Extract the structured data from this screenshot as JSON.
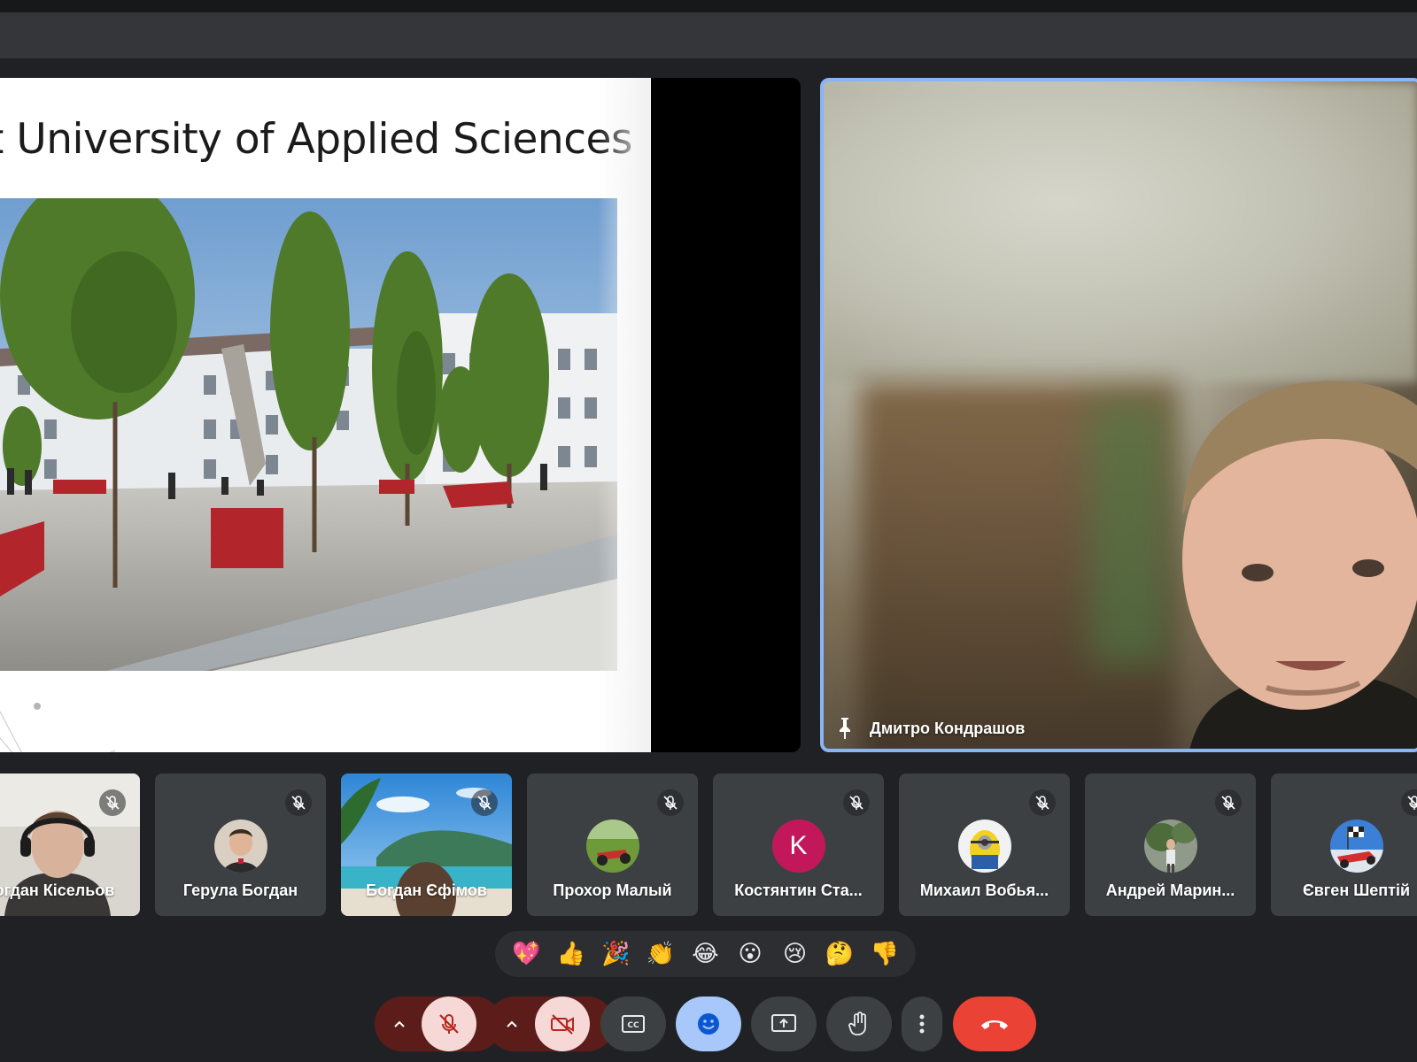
{
  "presentation": {
    "slide_title": "t University of Applied Sciences"
  },
  "pinned": {
    "name": "Дмитро Кондрашов"
  },
  "participants": [
    {
      "name": "огдан Кісельов",
      "avatar": "video"
    },
    {
      "name": "Герула Богдан",
      "avatar": "photo"
    },
    {
      "name": "Богдан Єфімов",
      "avatar": "video-background"
    },
    {
      "name": "Прохор Малый",
      "avatar": "photo"
    },
    {
      "name": "Костянтин Ста...",
      "avatar": "letter",
      "letter": "K"
    },
    {
      "name": "Михаил Вобья...",
      "avatar": "photo"
    },
    {
      "name": "Андрей Марин...",
      "avatar": "photo"
    },
    {
      "name": "Євген Шептій",
      "avatar": "photo"
    }
  ],
  "reactions": [
    "💖",
    "👍",
    "🎉",
    "👏",
    "😂",
    "😮",
    "😢",
    "🤔",
    "👎"
  ],
  "controls": {
    "mic_state": "muted",
    "camera_state": "off",
    "items": [
      "mic-options",
      "mic",
      "camera-options",
      "camera",
      "captions",
      "reactions",
      "present",
      "raise-hand",
      "more-options",
      "leave-call"
    ]
  },
  "colors": {
    "background": "#202124",
    "tile": "#3c4043",
    "active_border": "#8ab4f8",
    "danger": "#ea4335",
    "accent_blue": "#a8c7fa",
    "avatar_letter_bg": "#c2185b"
  }
}
